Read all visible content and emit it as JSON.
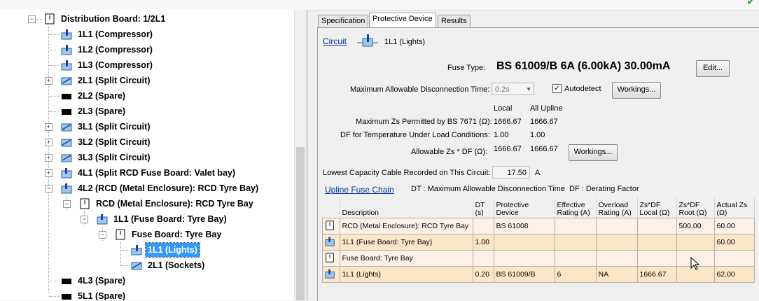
{
  "tree": {
    "nodes": [
      {
        "label": "Distribution Board: 1/2L1",
        "icon": "distribution-board-icon"
      },
      {
        "label": "1L1 (Compressor)",
        "icon": "circuit-icon"
      },
      {
        "label": "1L2 (Compressor)",
        "icon": "circuit-icon"
      },
      {
        "label": "1L3 (Compressor)",
        "icon": "circuit-icon"
      },
      {
        "label": "2L1 (Split Circuit)",
        "icon": "split-circuit-icon"
      },
      {
        "label": "2L2 (Spare)",
        "icon": "spare-icon"
      },
      {
        "label": "2L3 (Spare)",
        "icon": "spare-icon"
      },
      {
        "label": "3L1 (Split Circuit)",
        "icon": "split-circuit-icon"
      },
      {
        "label": "3L2 (Split Circuit)",
        "icon": "split-circuit-icon"
      },
      {
        "label": "3L3 (Split Circuit)",
        "icon": "split-circuit-icon"
      },
      {
        "label": "4L1 (Split RCD Fuse Board: Valet bay)",
        "icon": "fuse-board-icon"
      },
      {
        "label": "4L2 (RCD (Metal Enclosure): RCD Tyre Bay)",
        "icon": "fuse-board-icon"
      },
      {
        "label": "RCD (Metal Enclosure): RCD Tyre Bay",
        "icon": "enclosure-icon"
      },
      {
        "label": "1L1 (Fuse Board: Tyre Bay)",
        "icon": "fuse-board-icon"
      },
      {
        "label": "Fuse Board: Tyre Bay",
        "icon": "enclosure-icon"
      },
      {
        "label": "1L1 (Lights)",
        "icon": "circuit-icon"
      },
      {
        "label": "2L1 (Sockets)",
        "icon": "circuit-icon"
      },
      {
        "label": "4L3 (Spare)",
        "icon": "spare-icon"
      },
      {
        "label": "5L1 (Spare)",
        "icon": "spare-icon"
      }
    ]
  },
  "tabs": [
    "Specification",
    "Protective Device",
    "Results"
  ],
  "active_tab": "Protective Device",
  "circuit": {
    "link_label": "Circuit",
    "name": "1L1 (Lights)"
  },
  "fuse": {
    "label": "Fuse Type:",
    "value": "BS 61009/B 6A (6.00kA) 30.00mA",
    "edit_button": "Edit..."
  },
  "disconnection": {
    "label": "Maximum Allowable Disconnection Time:",
    "value": "0.2s",
    "autodetect_label": "Autodetect",
    "autodetect_checked": true,
    "workings_button": "Workings..."
  },
  "zs": {
    "col_local": "Local",
    "col_upline": "All Upline",
    "max_label": "Maximum Zs Permitted by BS 7671 (Ω):",
    "max_local": "1666.67",
    "max_upline": "1666.67",
    "df_label": "DF for Temperature Under Load Conditions:",
    "df_local": "1.00",
    "df_upline": "1.00",
    "allow_label": "Allowable Zs * DF (Ω):",
    "allow_local": "1666.67",
    "allow_upline": "1666.67",
    "workings_button": "Workings..."
  },
  "lowest_cable": {
    "label": "Lowest Capacity Cable Recorded on This Circuit:",
    "value": "17.50",
    "unit": "A"
  },
  "chain": {
    "link_label": "Upline Fuse Chain",
    "legend_dt": "DT : Maximum Allowable Disconnection Time",
    "legend_df": "DF : Derating Factor",
    "headers": [
      "Description",
      "DT (s)",
      "Protective Device",
      "Effective Rating (A)",
      "Overload Rating (A)",
      "Zs*DF Local (Ω)",
      "Zs*DF Root (Ω)",
      "Actual Zs (Ω)"
    ],
    "rows": [
      {
        "icon": "enclosure-icon",
        "description": "RCD (Metal Enclosure): RCD Tyre Bay",
        "dt": "",
        "device": "BS 61008",
        "effective": "",
        "overload": "",
        "local": "",
        "root": "500.00",
        "actual": "60.00"
      },
      {
        "icon": "fuse-board-icon",
        "description": "1L1 (Fuse Board: Tyre Bay)",
        "dt": "1.00",
        "device": "",
        "effective": "",
        "overload": "",
        "local": "",
        "root": "",
        "actual": "60.00"
      },
      {
        "icon": "enclosure-icon",
        "description": "Fuse Board: Tyre Bay",
        "dt": "",
        "device": "",
        "effective": "",
        "overload": "",
        "local": "",
        "root": "",
        "actual": ""
      },
      {
        "icon": "fuse-board-icon",
        "description": "1L1 (Lights)",
        "dt": "0.20",
        "device": "BS 61009/B",
        "effective": "6",
        "overload": "NA",
        "local": "1666.67",
        "root": "",
        "actual": "62.00"
      }
    ]
  }
}
